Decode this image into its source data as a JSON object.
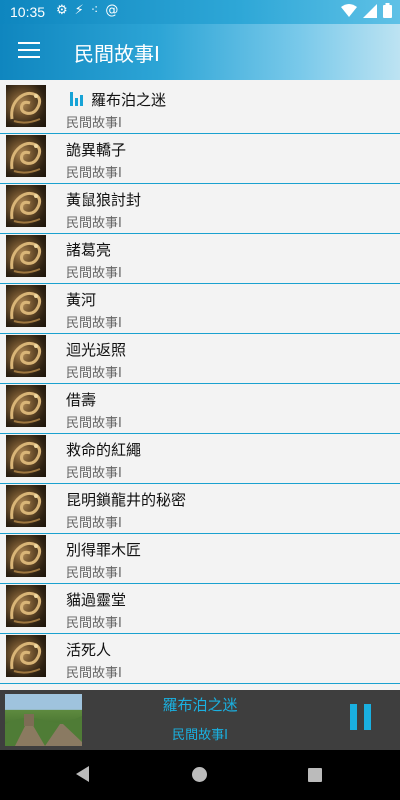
{
  "status": {
    "time": "10:35"
  },
  "toolbar": {
    "title": "民間故事I"
  },
  "list": {
    "items": [
      {
        "title": "羅布泊之迷",
        "subtitle": "民間故事I",
        "playing": true
      },
      {
        "title": "詭異轎子",
        "subtitle": "民間故事I"
      },
      {
        "title": "黃鼠狼討封",
        "subtitle": "民間故事I"
      },
      {
        "title": "諸葛亮",
        "subtitle": "民間故事I"
      },
      {
        "title": "黃河",
        "subtitle": "民間故事I"
      },
      {
        "title": "迴光返照",
        "subtitle": "民間故事I"
      },
      {
        "title": "借壽",
        "subtitle": "民間故事I"
      },
      {
        "title": "救命的紅繩",
        "subtitle": "民間故事I"
      },
      {
        "title": "昆明鎖龍井的秘密",
        "subtitle": "民間故事I"
      },
      {
        "title": "別得罪木匠",
        "subtitle": "民間故事I"
      },
      {
        "title": "貓過靈堂",
        "subtitle": "民間故事I"
      },
      {
        "title": "活死人",
        "subtitle": "民間故事I"
      }
    ]
  },
  "player": {
    "title": "羅布泊之迷",
    "subtitle": "民間故事I",
    "state": "playing"
  },
  "colors": {
    "accent": "#1ab0e0",
    "divider": "#1aa1cf",
    "player_bg": "#3e3e3e"
  }
}
